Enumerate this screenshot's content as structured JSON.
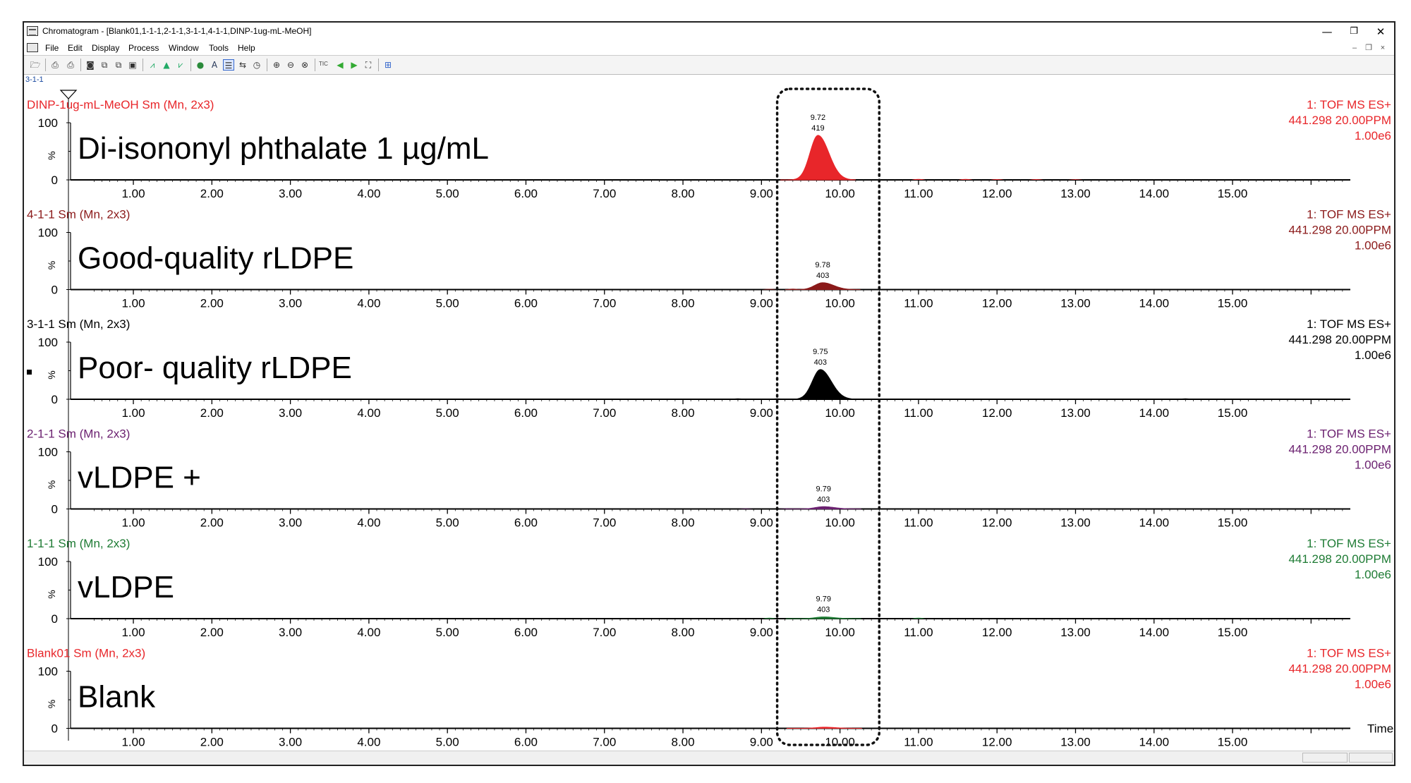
{
  "window": {
    "title": "Chromatogram - [Blank01,1-1-1,2-1-1,3-1-1,4-1-1,DINP-1ug-mL-MeOH]",
    "controls": {
      "minimize": "—",
      "restore": "❐",
      "close": "✕"
    }
  },
  "menu": [
    "File",
    "Edit",
    "Display",
    "Process",
    "Window",
    "Tools",
    "Help"
  ],
  "mdi_controls": {
    "minimize": "–",
    "restore": "❐",
    "close": "×"
  },
  "toolbar": {
    "tic_label": "TIC",
    "icons": [
      "open-icon",
      "print-icon",
      "print-preview-icon",
      "camera-icon",
      "copy-icon",
      "copy-list-icon",
      "paste-icon",
      "chromatogram-icon",
      "peaks-icon",
      "integrate-icon",
      "circle-icon",
      "text-a-icon",
      "layout-icon",
      "scale-icon",
      "timer-icon",
      "zoom-in-icon",
      "zoom-out-icon",
      "zoom-reset-icon",
      "arrow-left-icon",
      "arrow-right-icon",
      "fit-icon",
      "export-icon"
    ]
  },
  "top_label": "3-1-1",
  "x_axis": {
    "label": "Time",
    "min": 0.2,
    "max": 16.5,
    "ticks": [
      "1.00",
      "2.00",
      "3.00",
      "4.00",
      "5.00",
      "6.00",
      "7.00",
      "8.00",
      "9.00",
      "10.00",
      "11.00",
      "12.00",
      "13.00",
      "14.00",
      "15.00"
    ]
  },
  "y_axis": {
    "top": "100",
    "bottom": "0",
    "unit": "%"
  },
  "highlight_box": {
    "x_from": 9.2,
    "x_to": 10.5
  },
  "chart_data": [
    {
      "type": "line",
      "trace": "DINP-1ug-mL-MeOH Sm (Mn, 2x3)",
      "sample": "Di-isononyl phthalate 1 µg/mL",
      "color": "#e8262a",
      "detector": "1: TOF MS ES+",
      "mass": "441.298 20.00PPM",
      "intensity": "1.00e6",
      "peak": {
        "rt": 9.72,
        "area": 419,
        "rt_label": "9.72",
        "area_label": "419",
        "height_pct": 78,
        "width": 0.12
      },
      "minor": [
        [
          11.0,
          1.5
        ],
        [
          11.6,
          1.5
        ],
        [
          12.0,
          1.2
        ],
        [
          12.5,
          1.2
        ],
        [
          13.0,
          1.0
        ]
      ]
    },
    {
      "type": "line",
      "trace": "4-1-1 Sm (Mn, 2x3)",
      "sample": "Good-quality rLDPE",
      "color": "#8b1a1a",
      "detector": "1: TOF MS ES+",
      "mass": "441.298 20.00PPM",
      "intensity": "1.00e6",
      "peak": {
        "rt": 9.78,
        "area": 403,
        "rt_label": "9.78",
        "area_label": "403",
        "height_pct": 12,
        "width": 0.12
      },
      "minor": [
        [
          9.1,
          1.2
        ],
        [
          9.4,
          1.5
        ]
      ]
    },
    {
      "type": "line",
      "trace": "3-1-1 Sm (Mn, 2x3)",
      "sample": "Poor- quality rLDPE",
      "color": "#000000",
      "detector": "1: TOF MS ES+",
      "mass": "441.298 20.00PPM",
      "intensity": "1.00e6",
      "peak": {
        "rt": 9.75,
        "area": 403,
        "rt_label": "9.75",
        "area_label": "403",
        "height_pct": 52,
        "width": 0.12
      },
      "minor": [
        [
          8.7,
          1.5
        ],
        [
          9.2,
          1.5
        ],
        [
          14.4,
          1.5
        ]
      ]
    },
    {
      "type": "line",
      "trace": "2-1-1 Sm (Mn, 2x3)",
      "sample": "vLDPE +",
      "color": "#6b2170",
      "detector": "1: TOF MS ES+",
      "mass": "441.298 20.00PPM",
      "intensity": "1.00e6",
      "peak": {
        "rt": 9.79,
        "area": 403,
        "rt_label": "9.79",
        "area_label": "403",
        "height_pct": 4,
        "width": 0.12
      },
      "minor": [
        [
          8.8,
          1.0
        ],
        [
          9.3,
          1.0
        ]
      ]
    },
    {
      "type": "line",
      "trace": "1-1-1 Sm (Mn, 2x3)",
      "sample": "vLDPE",
      "color": "#1e7b34",
      "detector": "1: TOF MS ES+",
      "mass": "441.298 20.00PPM",
      "intensity": "1.00e6",
      "peak": {
        "rt": 9.79,
        "area": 403,
        "rt_label": "9.79",
        "area_label": "403",
        "height_pct": 3,
        "width": 0.12
      },
      "minor": [
        [
          9.1,
          1.5
        ],
        [
          11.0,
          1.5
        ]
      ]
    },
    {
      "type": "line",
      "trace": "Blank01 Sm (Mn, 2x3)",
      "sample": "Blank",
      "color": "#e8262a",
      "detector": "1: TOF MS ES+",
      "mass": "441.298 20.00PPM",
      "intensity": "1.00e6",
      "peak": {
        "rt": 9.8,
        "area": null,
        "rt_label": "",
        "area_label": "",
        "height_pct": 2,
        "width": 0.12
      },
      "minor": []
    }
  ]
}
